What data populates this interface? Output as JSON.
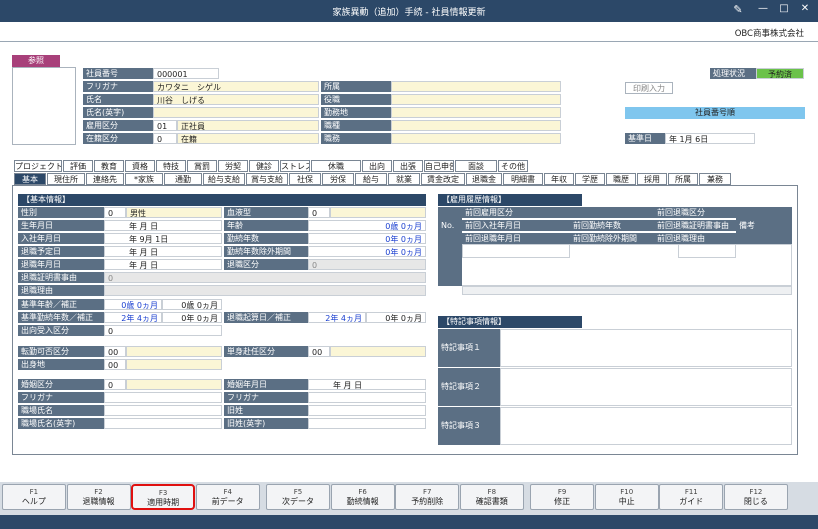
{
  "window": {
    "title": "家族異動（追加）手続 - 社員情報更新",
    "minimize": "—",
    "maximize": "□",
    "close": "✕",
    "icon": "tool-icon"
  },
  "company": "OBC商事株式会社",
  "photo_label": "参照",
  "shorten_input": "印刷入力",
  "status": {
    "label": "処理状況",
    "value": "予約済"
  },
  "employee_number_order": "社員番号順",
  "base_date": {
    "label": "基準日",
    "value": "年  1月  6日"
  },
  "header": {
    "employee_no": {
      "label": "社員番号",
      "value": "000001"
    },
    "furigana": {
      "label": "フリガナ",
      "value": "カワタニ　シゲル"
    },
    "name": {
      "label": "氏名",
      "value": "川谷　しげる"
    },
    "name_en": {
      "label": "氏名(英字)",
      "value": ""
    },
    "employment": {
      "label": "雇用区分",
      "code": "01",
      "value": "正社員"
    },
    "enrollment": {
      "label": "在籍区分",
      "code": "0",
      "value": "在籍"
    },
    "affiliation": {
      "label": "所属"
    },
    "position": {
      "label": "役職"
    },
    "workplace": {
      "label": "勤務地"
    },
    "job_type": {
      "label": "職種"
    },
    "duty": {
      "label": "職務"
    }
  },
  "tabs_row1": [
    "プロジェクト",
    "評価",
    "教育",
    "資格",
    "特技",
    "賞罰",
    "労契",
    "健診",
    "ストレスチ",
    "休職",
    "出向",
    "出張",
    "自己申告",
    "面談",
    "その他"
  ],
  "tabs_row2": [
    "基本",
    "現住所",
    "連絡先",
    "*家族",
    "通勤",
    "給与支給",
    "賞与支給",
    "社保",
    "労保",
    "給与",
    "就業",
    "賃金改定",
    "退職金",
    "明細書",
    "年収",
    "学歴",
    "職歴",
    "採用",
    "所属",
    "兼務"
  ],
  "basic": {
    "title": "【基本情報】",
    "gender": {
      "label": "性別",
      "code": "0",
      "value": "男性"
    },
    "birth": {
      "label": "生年月日",
      "value": "年  月  日"
    },
    "join": {
      "label": "入社年月日",
      "value": "年  9月  1日"
    },
    "retire_plan": {
      "label": "退職予定日",
      "value": "年  月  日"
    },
    "retire": {
      "label": "退職年月日",
      "value": "年  月  日"
    },
    "retire_cert": {
      "label": "退職証明書事由",
      "code": "0"
    },
    "retire_reason": {
      "label": "退職理由"
    },
    "blood": {
      "label": "血液型",
      "code": "0"
    },
    "age": {
      "label": "年齢",
      "value": "0歳  0ヵ月"
    },
    "years": {
      "label": "勤続年数",
      "value": "0年  0ヵ月"
    },
    "years_ex": {
      "label": "勤続年数除外期間",
      "value": "0年  0ヵ月"
    },
    "retire_type": {
      "label": "退職区分",
      "code": "0"
    },
    "base_age": {
      "label": "基準年齢／補正",
      "v1": "0歳  0ヵ月",
      "v2": "0歳  0ヵ月"
    },
    "base_years": {
      "label": "基準勤続年数／補正",
      "v1": "2年  4ヵ月",
      "v2": "0年  0ヵ月"
    },
    "retire_start": {
      "label": "退職起算日／補正",
      "v1": "2年  4ヵ月",
      "v2": "0年  0ヵ月"
    },
    "dispatch_in": {
      "label": "出向受入区分",
      "code": "0"
    },
    "transfer": {
      "label": "転勤可否区分",
      "code": "00"
    },
    "single": {
      "label": "単身赴任区分",
      "code": "00"
    },
    "birthplace": {
      "label": "出身地",
      "code": "00"
    },
    "marriage": {
      "label": "婚姻区分",
      "code": "0"
    },
    "marriage_date": {
      "label": "婚姻年月日",
      "value": "年  月  日"
    },
    "furigana1": {
      "label": "フリガナ"
    },
    "work_name": {
      "label": "職場氏名"
    },
    "work_name_en": {
      "label": "職場氏名(英字)"
    },
    "furigana2": {
      "label": "フリガナ"
    },
    "old_name": {
      "label": "旧姓"
    },
    "old_name_en": {
      "label": "旧姓(英字)"
    }
  },
  "history": {
    "title": "【雇用履歴情報】",
    "no": "No.",
    "cols": [
      "前回雇用区分",
      "前回入社年月日",
      "前回退職年月日",
      "前回勤続年数",
      "前回勤続除外期間",
      "前回退職区分",
      "前回退職証明書事由",
      "前回退職理由",
      "備考"
    ]
  },
  "special": {
    "title": "【特記事項情報】",
    "items": [
      "特記事項１",
      "特記事項２",
      "特記事項３"
    ]
  },
  "fkeys": [
    {
      "key": "F1",
      "label": "ヘルプ"
    },
    {
      "key": "F2",
      "label": "退職情報"
    },
    {
      "key": "F3",
      "label": "適用時期"
    },
    {
      "key": "F4",
      "label": "前データ"
    },
    {
      "key": "F5",
      "label": "次データ"
    },
    {
      "key": "F6",
      "label": "勤続情報"
    },
    {
      "key": "F7",
      "label": "予約削除"
    },
    {
      "key": "F8",
      "label": "確認書類"
    },
    {
      "key": "F9",
      "label": "修正"
    },
    {
      "key": "F10",
      "label": "中止"
    },
    {
      "key": "F11",
      "label": "ガイド"
    },
    {
      "key": "F12",
      "label": "閉じる"
    }
  ]
}
